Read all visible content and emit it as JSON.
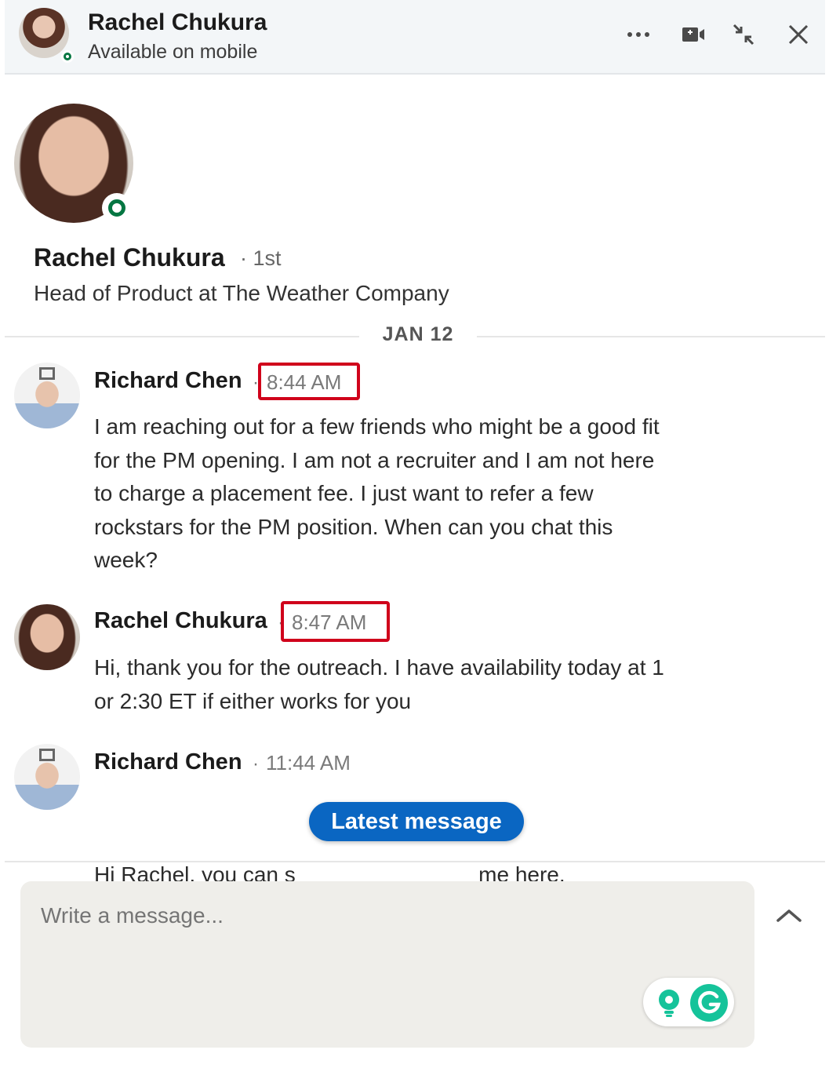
{
  "header": {
    "name": "Rachel Chukura",
    "status": "Available on mobile",
    "icons": [
      "more-options-icon",
      "video-call-icon",
      "collapse-icon",
      "close-icon"
    ]
  },
  "profile": {
    "name": "Rachel Chukura",
    "degree": "· 1st",
    "headline": "Head of Product at The Weather Company"
  },
  "date_divider": "JAN 12",
  "messages": [
    {
      "sender": "Richard Chen",
      "separator": "·",
      "time": "8:44 AM",
      "highlighted": true,
      "lines": [
        "I am reaching out for a few friends who might be a good fit",
        "for the PM opening. I am not a recruiter and I am not here",
        "to charge a placement fee. I just want to refer a few",
        "rockstars for the PM position. When can you chat this",
        "week?"
      ]
    },
    {
      "sender": "Rachel Chukura",
      "separator": "·",
      "time": "8:47 AM",
      "highlighted": true,
      "lines": [
        "Hi, thank you for the outreach. I have availability today at 1",
        "or 2:30 ET if either works for you"
      ]
    },
    {
      "sender": "Richard Chen",
      "separator": "·",
      "time": "11:44 AM",
      "highlighted": false,
      "lines": [
        "Hi Rachel, you can s                              me here."
      ]
    }
  ],
  "latest_message_button": "Latest message",
  "composer": {
    "placeholder": "Write a message..."
  },
  "colors": {
    "online": "#057642",
    "primary": "#0a66c2",
    "highlight_box": "#d0021b",
    "grammarly": "#15c39a"
  }
}
